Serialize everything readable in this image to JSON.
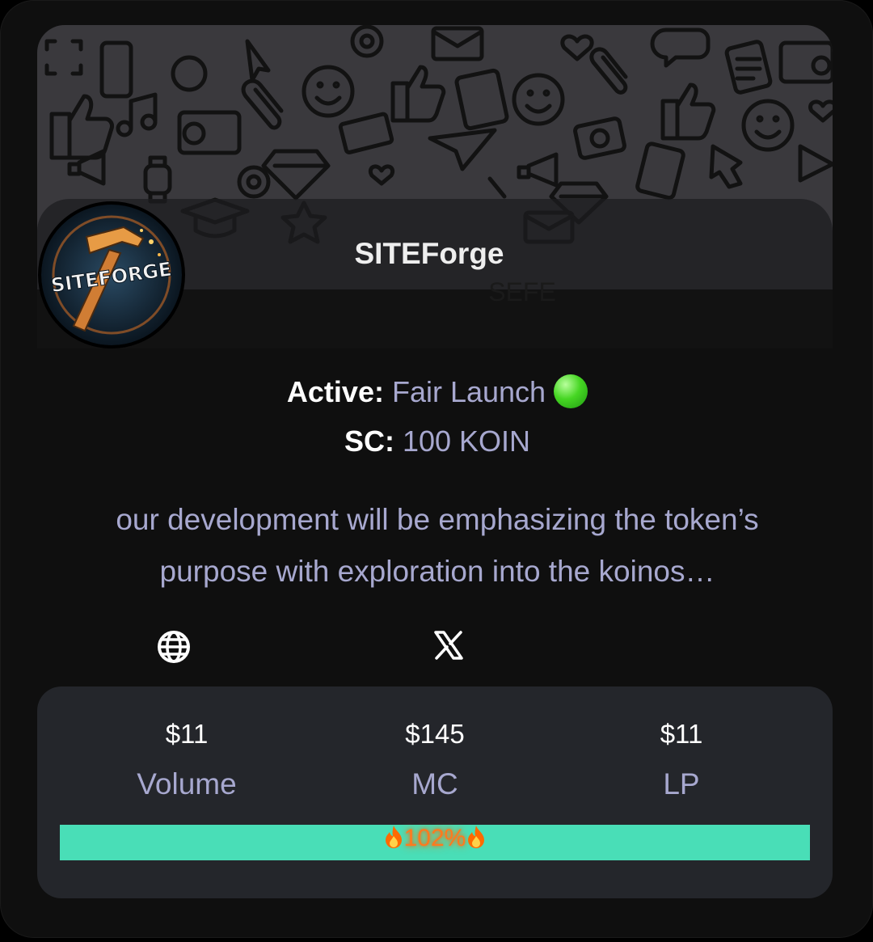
{
  "token": {
    "name": "SITEForge",
    "symbol": "SEFE",
    "logo_text": "SITEFORGE"
  },
  "status": {
    "label": "Active:",
    "value": "Fair Launch",
    "indicator_color": "#3fd11f"
  },
  "soft_cap": {
    "label": "SC:",
    "value": "100 KOIN"
  },
  "description": "our development will be emphasizing the token’s purpose with exploration into the koinos…",
  "links": {
    "website_icon": "globe-icon",
    "x_icon": "x-icon"
  },
  "stats": {
    "volume": {
      "value": "$11",
      "label": "Volume"
    },
    "mc": {
      "value": "$145",
      "label": "MC"
    },
    "lp": {
      "value": "$11",
      "label": "LP"
    }
  },
  "progress": {
    "percent": 102,
    "label": "102%",
    "fill_color": "#49deb7",
    "label_color": "#ff7a1e"
  },
  "colors": {
    "card_bg": "#0f0f0f",
    "stats_bg": "#24262b",
    "muted_text": "#a7a8cf"
  }
}
